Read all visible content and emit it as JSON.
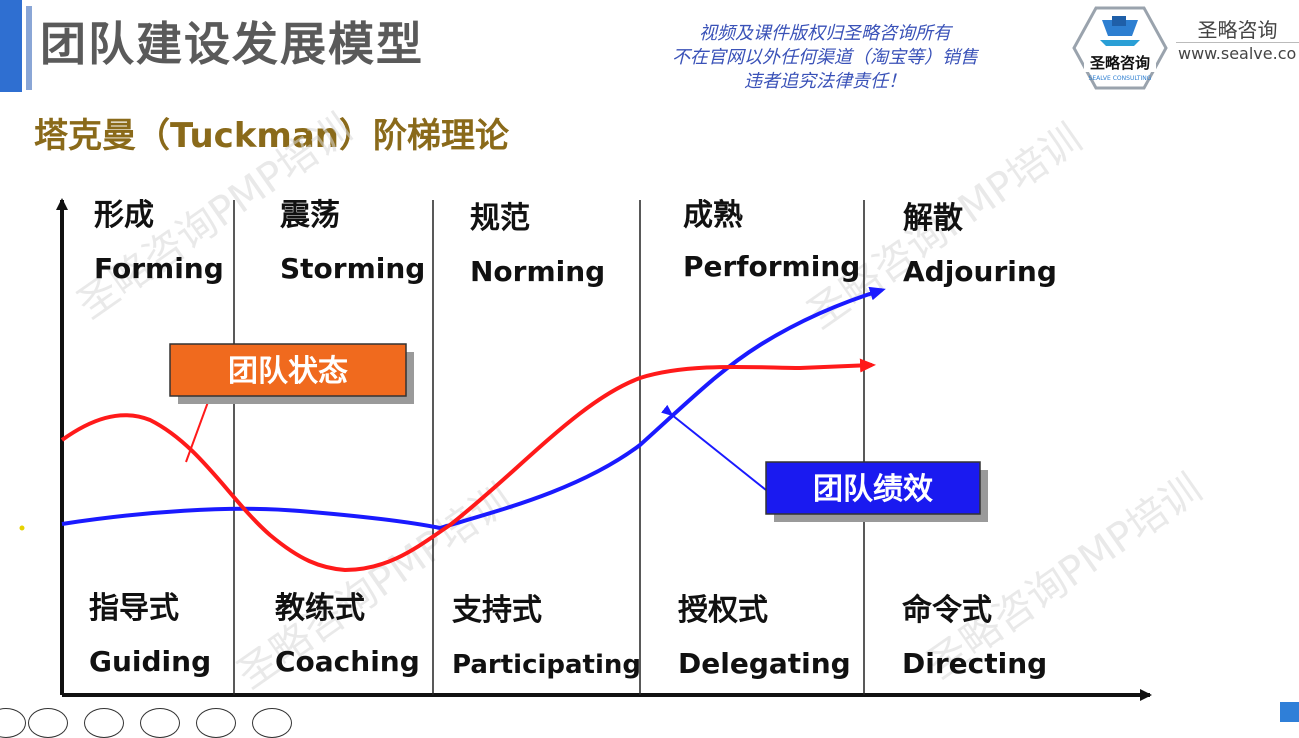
{
  "header": {
    "title": "团队建设发展模型",
    "copyright_lines": [
      "视频及课件版权归圣略咨询所有",
      "不在官网以外任何渠道（淘宝等）销售",
      "违者追究法律责任！"
    ],
    "brand": {
      "name": "圣略咨询",
      "url": "www.sealve.co",
      "logo_text": "圣略咨询",
      "logo_subtext": "SEALVE CONSULTING"
    }
  },
  "subtitle": "塔克曼（Tuckman）阶梯理论",
  "diagram": {
    "stages": [
      {
        "cn": "形成",
        "en": "Forming"
      },
      {
        "cn": "震荡",
        "en": "Storming"
      },
      {
        "cn": "规范",
        "en": "Norming"
      },
      {
        "cn": "成熟",
        "en": "Performing"
      },
      {
        "cn": "解散",
        "en": "Adjouring"
      }
    ],
    "leadership": [
      {
        "cn": "指导式",
        "en": "Guiding"
      },
      {
        "cn": "教练式",
        "en": "Coaching"
      },
      {
        "cn": "支持式",
        "en": "Participating"
      },
      {
        "cn": "授权式",
        "en": "Delegating"
      },
      {
        "cn": "命令式",
        "en": "Directing"
      }
    ],
    "labels": {
      "team_state": "团队状态",
      "team_performance": "团队绩效"
    },
    "colors": {
      "state_curve": "#ff1a1a",
      "performance_curve": "#1a1aff",
      "state_box": "#f06a1e",
      "performance_box": "#1a1af0"
    }
  },
  "watermark": "圣略咨询PMP培训"
}
